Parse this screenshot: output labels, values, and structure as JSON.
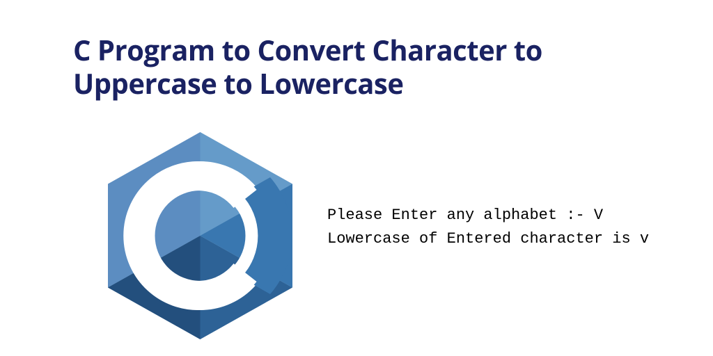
{
  "title": "C Program to Convert Character to Uppercase to Lowercase",
  "logo": {
    "name": "c-language-logo"
  },
  "output": {
    "line1": "Please Enter any alphabet :- V",
    "line2": "Lowercase of Entered character is v"
  },
  "colors": {
    "title": "#1a2262",
    "logo_light": "#5c8dc1",
    "logo_mid": "#4476ab",
    "logo_dark": "#2d6296",
    "logo_deep": "#1e4a78"
  }
}
